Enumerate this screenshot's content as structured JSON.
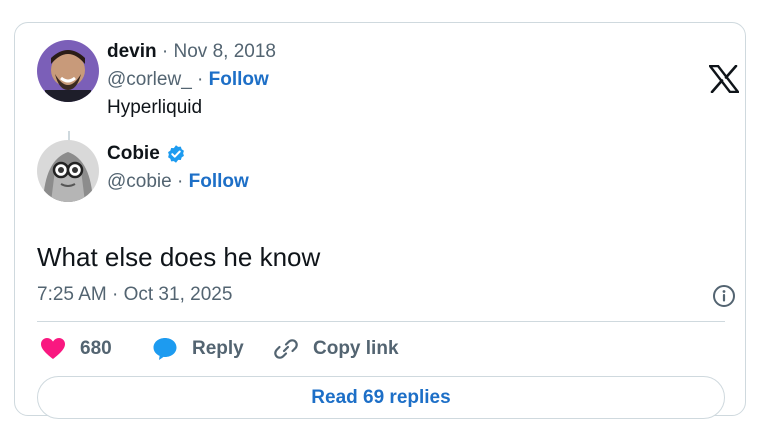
{
  "parent_tweet": {
    "author_name": "devin",
    "separator": "·",
    "date": "Nov 8, 2018",
    "handle": "@corlew_",
    "follow_label": "Follow",
    "text": "Hyperliquid",
    "avatar_icon": "user-avatar-photo"
  },
  "tweet": {
    "author_name": "Cobie",
    "verified": true,
    "verified_color": "#1d9bf0",
    "handle": "@cobie",
    "separator": "·",
    "follow_label": "Follow",
    "text": "What else does he know",
    "timestamp": "7:25 AM · Oct 31, 2025",
    "avatar_icon": "user-avatar-photo"
  },
  "actions": {
    "like_count": "680",
    "like_icon": "heart-icon",
    "like_color": "#f91880",
    "reply_label": "Reply",
    "reply_icon": "speech-bubble-icon",
    "reply_color": "#1d9bf0",
    "copy_label": "Copy link",
    "copy_icon": "link-icon"
  },
  "read_replies_label": "Read 69 replies",
  "brand": {
    "logo": "x-logo",
    "link_color": "#1d6fc7"
  }
}
